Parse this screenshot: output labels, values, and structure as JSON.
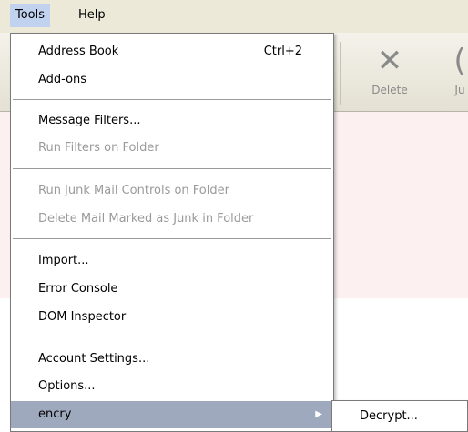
{
  "menubar": {
    "tools": "Tools",
    "help": "Help"
  },
  "toolbar": {
    "delete_label": "Delete",
    "junk_label": "Ju"
  },
  "menu": {
    "address_book": {
      "label": "Address Book",
      "shortcut": "Ctrl+2"
    },
    "addons": "Add-ons",
    "message_filters": "Message Filters...",
    "run_filters": "Run Filters on Folder",
    "run_junk": "Run Junk Mail Controls on Folder",
    "delete_junk": "Delete Mail Marked as Junk in Folder",
    "import": "Import...",
    "error_console": "Error Console",
    "dom_inspector": "DOM Inspector",
    "account_settings": "Account Settings...",
    "options": "Options...",
    "encry": "encry"
  },
  "submenu": {
    "decrypt": "Decrypt..."
  },
  "icons": {
    "delete": "close-x-icon",
    "junk": "junk-icon",
    "submenu_arrow": "chevron-right-icon"
  }
}
